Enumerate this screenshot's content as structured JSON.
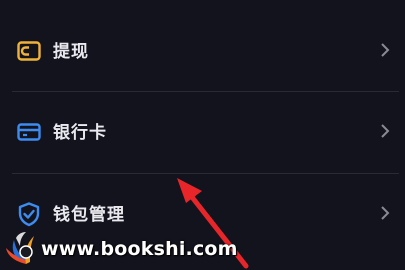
{
  "menu": {
    "items": [
      {
        "label": "提现",
        "icon": "wallet-icon",
        "icon_color": "#f0b33a"
      },
      {
        "label": "银行卡",
        "icon": "bank-card-icon",
        "icon_color": "#3d8cf0"
      },
      {
        "label": "钱包管理",
        "icon": "shield-check-icon",
        "icon_color": "#3d8cf0"
      }
    ]
  },
  "annotation": {
    "arrow_color": "#e8262a"
  },
  "watermark": {
    "text": "www.bookshi.com"
  },
  "colors": {
    "background": "#13131d",
    "divider": "#2a2a36",
    "label": "#e9e9ef",
    "chevron": "#8a8a96"
  }
}
